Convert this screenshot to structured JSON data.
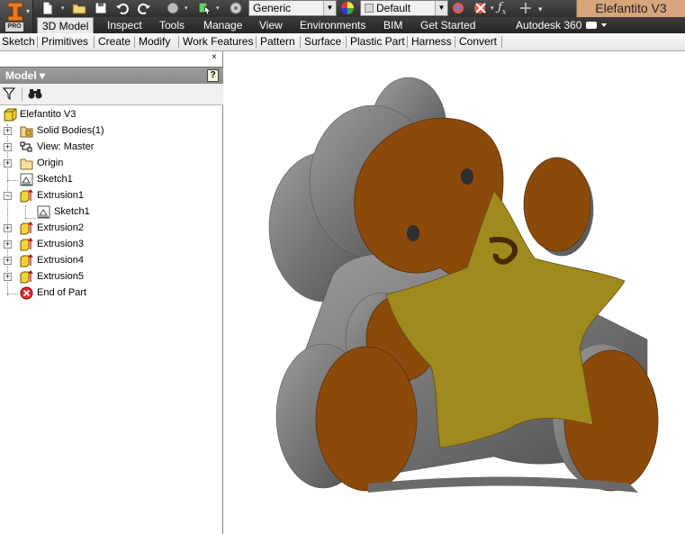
{
  "app": {
    "edition_badge": "PRO",
    "document_title": "Elefantito V3"
  },
  "quick_access": {
    "material_combo": "Generic",
    "appearance_combo": "Default"
  },
  "ribbon": {
    "tabs": [
      {
        "label": "3D Model",
        "active": true
      },
      {
        "label": "Inspect"
      },
      {
        "label": "Tools"
      },
      {
        "label": "Manage"
      },
      {
        "label": "View"
      },
      {
        "label": "Environments"
      },
      {
        "label": "BIM"
      },
      {
        "label": "Get Started"
      },
      {
        "label": "Autodesk 360"
      }
    ],
    "panels": [
      "Sketch",
      "Primitives",
      "Create",
      "Modify",
      "Work Features",
      "Pattern",
      "Surface",
      "Plastic Part",
      "Harness",
      "Convert"
    ]
  },
  "browser": {
    "title": "Model ▾",
    "help_icon": "?",
    "close_icon": "×",
    "tree": [
      {
        "label": "Elefantito V3",
        "icon": "part-icon"
      },
      {
        "label": "Solid Bodies(1)",
        "icon": "solid-bodies-icon"
      },
      {
        "label": "View: Master",
        "icon": "view-icon"
      },
      {
        "label": "Origin",
        "icon": "folder-icon"
      },
      {
        "label": "Sketch1",
        "icon": "sketch-icon"
      },
      {
        "label": "Extrusion1",
        "icon": "extrusion-icon"
      },
      {
        "label": "Sketch1",
        "icon": "sketch-icon"
      },
      {
        "label": "Extrusion2",
        "icon": "extrusion-icon"
      },
      {
        "label": "Extrusion3",
        "icon": "extrusion-icon"
      },
      {
        "label": "Extrusion4",
        "icon": "extrusion-icon"
      },
      {
        "label": "Extrusion5",
        "icon": "extrusion-icon"
      },
      {
        "label": "End of Part",
        "icon": "end-of-part-icon"
      }
    ]
  },
  "colors": {
    "body_orange": "#8b4a0c",
    "star_yellow": "#a08a1e",
    "extrusion_gray": "#8e8e8e",
    "title_bg": "#d7a57c"
  }
}
